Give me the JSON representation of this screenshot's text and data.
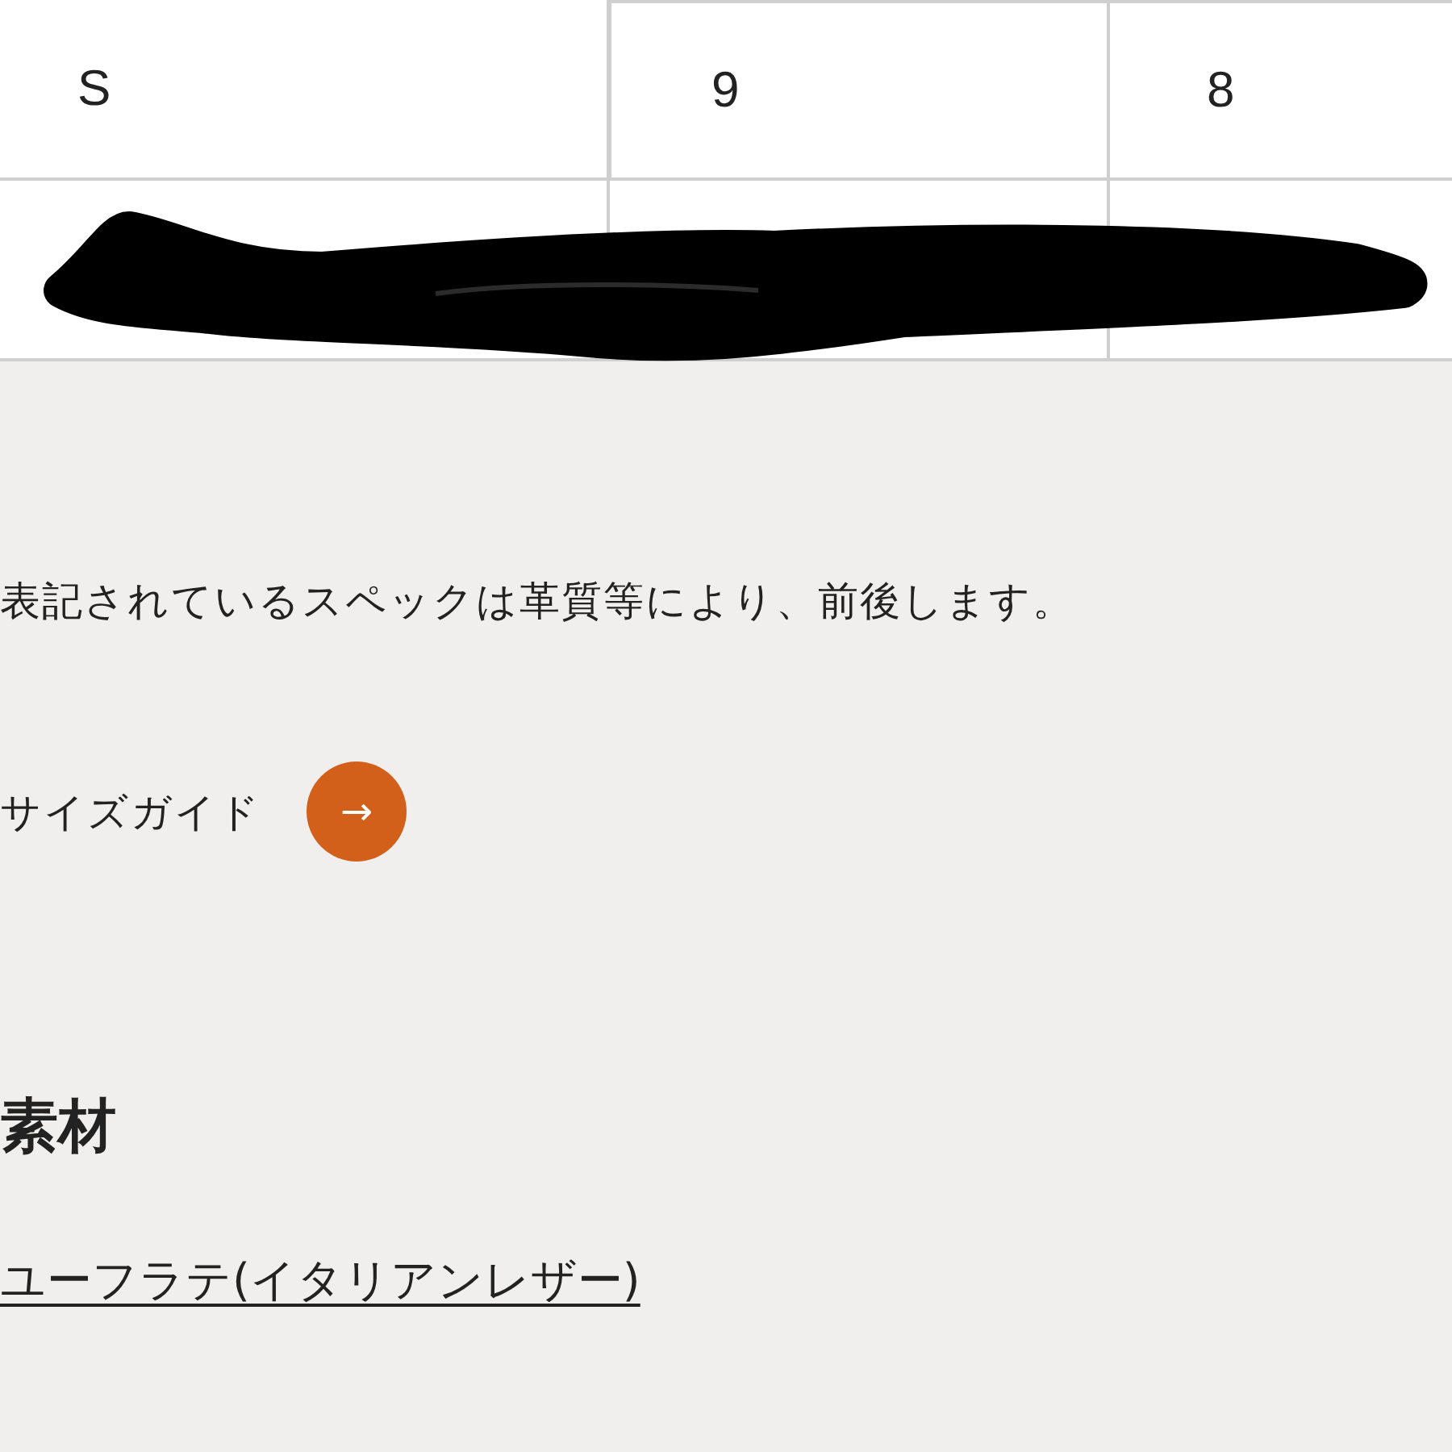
{
  "size_table": {
    "rows": [
      {
        "cells": [
          "S",
          "9",
          "8"
        ]
      },
      {
        "redacted": true
      }
    ]
  },
  "note": "表記されているスペックは革質等により、前後します。",
  "size_guide": {
    "label": "サイズガイド",
    "arrow": "→"
  },
  "material": {
    "heading": "素材",
    "link": "ユーフラテ(イタリアンレザー)"
  }
}
